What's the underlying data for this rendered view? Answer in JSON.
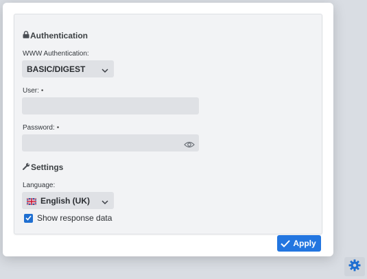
{
  "authentication": {
    "title": "Authentication",
    "www_auth_label": "WWW Authentication:",
    "www_auth_value": "BASIC/DIGEST",
    "user_label": "User:",
    "user_value": "",
    "password_label": "Password:",
    "password_value": "",
    "required_marker": "•"
  },
  "settings": {
    "title": "Settings",
    "language_label": "Language:",
    "language_value": "English (UK)",
    "show_response_label": "Show response data",
    "show_response_checked": true
  },
  "actions": {
    "apply_label": "Apply"
  },
  "colors": {
    "accent": "#2376e0",
    "checkbox": "#1f6fd1"
  },
  "icons": {
    "auth_section": "lock-icon",
    "settings_section": "wrench-icon",
    "password_toggle": "eye-icon",
    "select_arrow": "chevron-down-icon",
    "language_flag": "uk-flag-icon",
    "apply": "checkmark-icon",
    "corner_button": "gear-icon"
  }
}
